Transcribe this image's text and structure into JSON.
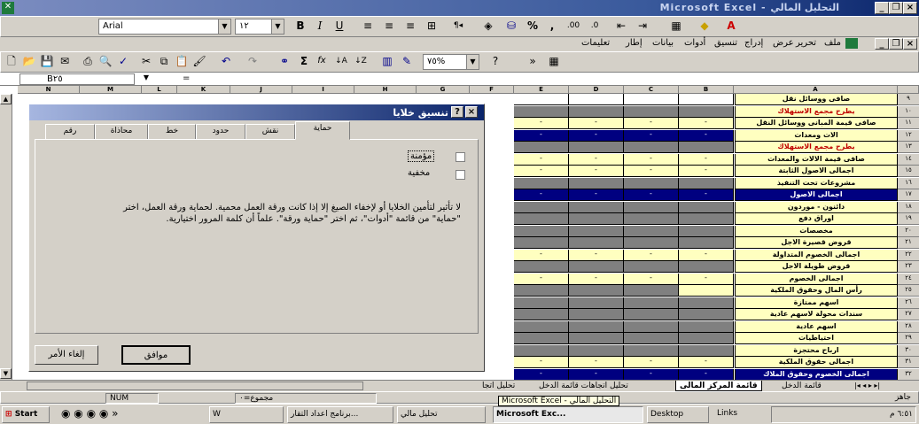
{
  "window": {
    "title": "Microsoft Excel - التحليل المالي"
  },
  "format_bar": {
    "font_name": "Arial",
    "font_size": "١٢",
    "bold": "B",
    "italic": "I",
    "underline": "U",
    "percent": "%",
    "comma": ","
  },
  "menu": {
    "items": [
      "ملف",
      "تحرير",
      "عرض",
      "إدراج",
      "تنسيق",
      "أدوات",
      "بيانات",
      "إطار",
      "تعليمات"
    ]
  },
  "standard_bar": {
    "zoom": "٧٥%",
    "sum": "Σ",
    "fx": "fx"
  },
  "formula_bar": {
    "name_box": "B٢٥",
    "formula": "="
  },
  "columns": [
    "N",
    "M",
    "L",
    "K",
    "J",
    "I",
    "H",
    "G",
    "F",
    "E",
    "D",
    "C",
    "B",
    "A"
  ],
  "rows": [
    {
      "num": "٩",
      "label": "صافى ووسائل نقل",
      "style": "normal",
      "cells": "blank"
    },
    {
      "num": "١٠",
      "label": "يطرح مجمع الاستهلاك",
      "style": "red",
      "cells": "gray"
    },
    {
      "num": "١١",
      "label": "صافى قيمة المبانى ووسائل النقل",
      "style": "normal",
      "cells": "yellow"
    },
    {
      "num": "١٢",
      "label": "الات ومعدات",
      "style": "normal",
      "cells": "navy"
    },
    {
      "num": "١٣",
      "label": "يطرح مجمع الاستهلاك",
      "style": "red",
      "cells": "gray"
    },
    {
      "num": "١٤",
      "label": "صافى قيمة الالات والمعدات",
      "style": "normal",
      "cells": "yellow"
    },
    {
      "num": "١٥",
      "label": "اجمالى الاصول الثابتة",
      "style": "normal",
      "cells": "yellow"
    },
    {
      "num": "١٦",
      "label": "مشروعات تحت التنفيذ",
      "style": "normal",
      "cells": "gray"
    },
    {
      "num": "١٧",
      "label": "اجمالى الاصول",
      "style": "dark",
      "cells": "navy"
    },
    {
      "num": "١٨",
      "label": "دائنون - موردون",
      "style": "normal",
      "cells": "gray"
    },
    {
      "num": "١٩",
      "label": "اوراق دفع",
      "style": "normal",
      "cells": "gray"
    },
    {
      "num": "٢٠",
      "label": "مخصصات",
      "style": "normal",
      "cells": "gray"
    },
    {
      "num": "٢١",
      "label": "قروض قصيرة الاجل",
      "style": "normal",
      "cells": "gray"
    },
    {
      "num": "٢٢",
      "label": "اجمالى الخصوم المتداولة",
      "style": "normal",
      "cells": "yellow"
    },
    {
      "num": "٢٣",
      "label": "قروض طويلة الاجل",
      "style": "normal",
      "cells": "gray"
    },
    {
      "num": "٢٤",
      "label": "اجمالى الخصوم",
      "style": "normal",
      "cells": "yellow"
    },
    {
      "num": "٢٥",
      "label": "رأس المال وحقوق الملكية",
      "style": "normal",
      "cells": "selected"
    },
    {
      "num": "٢٦",
      "label": "اسهم ممتازة",
      "style": "normal",
      "cells": "gray"
    },
    {
      "num": "٢٧",
      "label": "سندات محولة لاسهم عادية",
      "style": "normal",
      "cells": "gray"
    },
    {
      "num": "٢٨",
      "label": "اسهم عادية",
      "style": "normal",
      "cells": "gray"
    },
    {
      "num": "٢٩",
      "label": "احتياطيات",
      "style": "normal",
      "cells": "gray"
    },
    {
      "num": "٣٠",
      "label": "ارباح محتجزة",
      "style": "normal",
      "cells": "gray"
    },
    {
      "num": "٣١",
      "label": "اجمالى حقوق الملكية",
      "style": "normal",
      "cells": "yellow"
    },
    {
      "num": "٣٢",
      "label": "اجمالى الخصوم وحقوق الملاك",
      "style": "dark",
      "cells": "navy"
    }
  ],
  "dialog": {
    "title": "تنسيق خلايا",
    "tabs": [
      "رقم",
      "محاذاة",
      "خط",
      "حدود",
      "نقش",
      "حماية"
    ],
    "active_tab": "حماية",
    "locked_label": "مؤمنة",
    "hidden_label": "مخفية",
    "info_text": "لا تأثير لتأمين الخلايا أو لإخفاء الصيغ إلا إذا كانت ورقة العمل محمية. لحماية ورقة العمل، اختر \"حماية\" من قائمة \"أدوات\"، ثم اختر \"حماية ورقة\". علماً أن كلمة المرور اختيارية.",
    "ok": "موافق",
    "cancel": "إلغاء الأمر"
  },
  "sheet_tabs": [
    "قائمة الدخل",
    "قائمة المركز المالى",
    "تحليل اتجاهات قائمة الدخل",
    "تحليل اتجا"
  ],
  "active_sheet": "قائمة المركز المالى",
  "status": {
    "ready": "جاهز",
    "sum": "مجموع=٠",
    "num": "NUM"
  },
  "taskbar": {
    "start": "Start",
    "tasks": [
      "تحليل مالي",
      "برنامج اعداد التقار...",
      "Microsoft Exc...",
      "Desktop",
      "Links"
    ],
    "tooltip": "Microsoft Excel - التحليل المالي",
    "clock": "٦:٥١ م"
  }
}
